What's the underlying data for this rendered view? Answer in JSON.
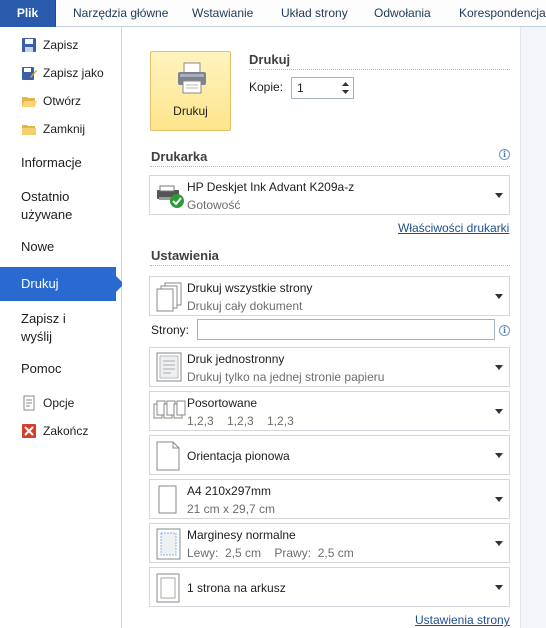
{
  "ribbon": {
    "tabs": [
      "Plik",
      "Narzędzia główne",
      "Wstawianie",
      "Układ strony",
      "Odwołania",
      "Korespondencja"
    ]
  },
  "nav": {
    "save": "Zapisz",
    "save_as": "Zapisz jako",
    "open": "Otwórz",
    "close": "Zamknij",
    "info": "Informacje",
    "recent": "Ostatnio używane",
    "new": "Nowe",
    "print": "Drukuj",
    "save_send": "Zapisz i wyślij",
    "help": "Pomoc",
    "options": "Opcje",
    "exit": "Zakończ"
  },
  "print": {
    "button_label": "Drukuj",
    "title": "Drukuj",
    "copies_label": "Kopie:",
    "copies_value": "1"
  },
  "printer": {
    "section_title": "Drukarka",
    "name": "HP Deskjet Ink Advant K209a-z",
    "status": "Gotowość",
    "properties_link": "Właściwości drukarki"
  },
  "settings": {
    "section_title": "Ustawienia",
    "pages_label": "Strony:",
    "pages_value": "",
    "page_setup_link": "Ustawienia strony",
    "options": [
      {
        "title": "Drukuj wszystkie strony",
        "subtitle": "Drukuj cały dokument"
      },
      {
        "title": "Druk jednostronny",
        "subtitle": "Drukuj tylko na jednej stronie papieru"
      },
      {
        "title": "Posortowane",
        "subtitle": "1,2,3    1,2,3    1,2,3"
      },
      {
        "title": "Orientacja pionowa",
        "subtitle": ""
      },
      {
        "title": "A4 210x297mm",
        "subtitle": "21 cm x 29,7 cm"
      },
      {
        "title": "Marginesy normalne",
        "subtitle": "Lewy:  2,5 cm    Prawy:  2,5 cm"
      },
      {
        "title": "1 strona na arkusz",
        "subtitle": ""
      }
    ]
  },
  "colors": {
    "file_tab": "#2a5aab",
    "selected_nav": "#2a6ad0",
    "print_button": "#fde58c",
    "link": "#1e4e8c"
  }
}
